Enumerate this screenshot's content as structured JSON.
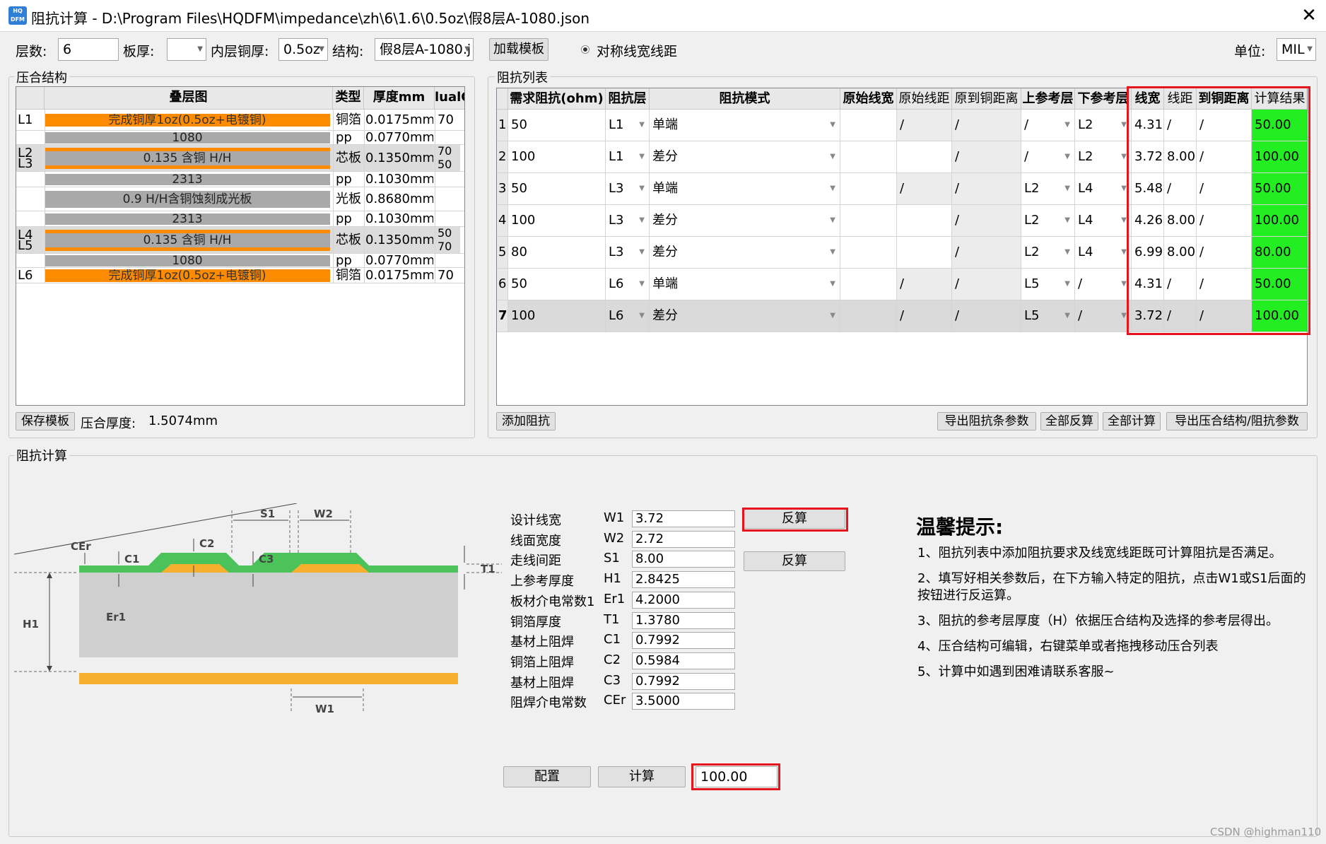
{
  "window": {
    "icon_text": "HQ DFM",
    "title": "阻抗计算 - D:\\Program Files\\HQDFM\\impedance\\zh\\6\\1.6\\0.5oz\\假8层A-1080.json",
    "close_glyph": "✕"
  },
  "toolbar": {
    "layers_label": "层数:",
    "layers_value": "6",
    "thickness_label": "板厚:",
    "thickness_value": "",
    "inner_cu_label": "内层铜厚:",
    "inner_cu_value": "0.5oz",
    "structure_label": "结构:",
    "structure_value": "假8层A-1080.j",
    "load_template_label": "加载模板",
    "symmetric_radio_label": "对称线宽线距",
    "unit_label": "单位:",
    "unit_value": "MIL"
  },
  "stackup": {
    "group_title": "压合结构",
    "columns": [
      "叠层图",
      "类型",
      "厚度mm",
      "lualCo"
    ],
    "rows": [
      {
        "layer": "L1",
        "diagram": "完成铜厚1oz(0.5oz+电镀铜)",
        "kind": "copper",
        "type": "铜箔",
        "thickness": "0.0175mm",
        "dual": "70"
      },
      {
        "layer": "",
        "diagram": "1080",
        "kind": "pp",
        "type": "pp",
        "thickness": "0.0770mm",
        "dual": ""
      },
      {
        "layer": "L2",
        "layer2": "L3",
        "diagram": "0.135 含铜 H/H",
        "kind": "core",
        "type": "芯板",
        "thickness": "0.1350mm",
        "dual": "70",
        "dual2": "50"
      },
      {
        "layer": "",
        "diagram": "2313",
        "kind": "pp",
        "type": "pp",
        "thickness": "0.1030mm",
        "dual": ""
      },
      {
        "layer": "",
        "diagram": "0.9 H/H含铜蚀刻成光板",
        "kind": "bare",
        "type": "光板",
        "thickness": "0.8680mm",
        "dual": ""
      },
      {
        "layer": "",
        "diagram": "2313",
        "kind": "pp",
        "type": "pp",
        "thickness": "0.1030mm",
        "dual": ""
      },
      {
        "layer": "L4",
        "layer2": "L5",
        "diagram": "0.135 含铜 H/H",
        "kind": "core",
        "type": "芯板",
        "thickness": "0.1350mm",
        "dual": "50",
        "dual2": "70"
      },
      {
        "layer": "",
        "diagram": "1080",
        "kind": "pp",
        "type": "pp",
        "thickness": "0.0770mm",
        "dual": ""
      },
      {
        "layer": "L6",
        "diagram": "完成铜厚1oz(0.5oz+电镀铜)",
        "kind": "copper",
        "type": "铜箔",
        "thickness": "0.0175mm",
        "dual": "70"
      }
    ],
    "save_template_label": "保存模板",
    "total_thickness_label": "压合厚度:",
    "total_thickness_value": "1.5074mm"
  },
  "impedance_list": {
    "group_title": "阻抗列表",
    "columns": [
      "需求阻抗(ohm)",
      "阻抗层",
      "阻抗模式",
      "原始线宽",
      "原始线距",
      "原到铜距离",
      "上参考层",
      "下参考层",
      "线宽",
      "线距",
      "到铜距离",
      "计算结果"
    ],
    "rows": [
      {
        "n": "1",
        "req": "50",
        "layer": "L1",
        "mode": "单端",
        "ow": "",
        "os": "/",
        "oc": "/",
        "top": "/",
        "bot": "L2",
        "w": "4.31",
        "s": "/",
        "c": "/",
        "result": "50.00"
      },
      {
        "n": "2",
        "req": "100",
        "layer": "L1",
        "mode": "差分",
        "ow": "",
        "os": "",
        "oc": "/",
        "top": "/",
        "bot": "L2",
        "w": "3.72",
        "s": "8.00",
        "c": "/",
        "result": "100.00"
      },
      {
        "n": "3",
        "req": "50",
        "layer": "L3",
        "mode": "单端",
        "ow": "",
        "os": "/",
        "oc": "/",
        "top": "L2",
        "bot": "L4",
        "w": "5.48",
        "s": "/",
        "c": "/",
        "result": "50.00"
      },
      {
        "n": "4",
        "req": "100",
        "layer": "L3",
        "mode": "差分",
        "ow": "",
        "os": "",
        "oc": "/",
        "top": "L2",
        "bot": "L4",
        "w": "4.26",
        "s": "8.00",
        "c": "/",
        "result": "100.00"
      },
      {
        "n": "5",
        "req": "80",
        "layer": "L3",
        "mode": "差分",
        "ow": "",
        "os": "",
        "oc": "/",
        "top": "L2",
        "bot": "L4",
        "w": "6.99",
        "s": "8.00",
        "c": "/",
        "result": "80.00"
      },
      {
        "n": "6",
        "req": "50",
        "layer": "L6",
        "mode": "单端",
        "ow": "",
        "os": "/",
        "oc": "/",
        "top": "L5",
        "bot": "/",
        "w": "4.31",
        "s": "/",
        "c": "/",
        "result": "50.00"
      },
      {
        "n": "7",
        "req": "100",
        "layer": "L6",
        "mode": "差分",
        "ow": "",
        "os": "/",
        "oc": "/",
        "top": "L5",
        "bot": "/",
        "w": "3.72",
        "s": "/",
        "c": "/",
        "result": "100.00"
      }
    ],
    "add_label": "添加阻抗",
    "export_bar_label": "导出阻抗条参数",
    "reverse_all_label": "全部反算",
    "calc_all_label": "全部计算",
    "export_stack_label": "导出压合结构/阻抗参数"
  },
  "calc": {
    "group_title": "阻抗计算",
    "diagram": {
      "S1": "S1",
      "W2": "W2",
      "CEr": "CEr",
      "C1": "C1",
      "C2": "C2",
      "C3": "C3",
      "T1": "T1",
      "H1": "H1",
      "Er1": "Er1",
      "W1": "W1"
    },
    "fields": [
      {
        "label": "设计线宽",
        "sym": "W1",
        "value": "3.72"
      },
      {
        "label": "线面宽度",
        "sym": "W2",
        "value": "2.72"
      },
      {
        "label": "走线间距",
        "sym": "S1",
        "value": "8.00"
      },
      {
        "label": "上参考厚度",
        "sym": "H1",
        "value": "2.8425"
      },
      {
        "label": "板材介电常数1",
        "sym": "Er1",
        "value": "4.2000"
      },
      {
        "label": "铜箔厚度",
        "sym": "T1",
        "value": "1.3780"
      },
      {
        "label": "基材上阻焊",
        "sym": "C1",
        "value": "0.7992"
      },
      {
        "label": "铜箔上阻焊",
        "sym": "C2",
        "value": "0.5984"
      },
      {
        "label": "基材上阻焊",
        "sym": "C3",
        "value": "0.7992"
      },
      {
        "label": "阻焊介电常数",
        "sym": "CEr",
        "value": "3.5000"
      }
    ],
    "reverse_w1_label": "反算",
    "reverse_s1_label": "反算",
    "config_label": "配置",
    "calc_label": "计算",
    "result_value": "100.00",
    "tips_title": "温馨提示:",
    "tips": [
      "1、阻抗列表中添加阻抗要求及线宽线距既可计算阻抗是否满足。",
      "2、填写好相关参数后，在下方输入特定的阻抗，点击W1或S1后面的",
      "按钮进行反运算。",
      "3、阻抗的参考层厚度（H）依据压合结构及选择的参考层得出。",
      "4、压合结构可编辑，右键菜单或者拖拽移动压合列表",
      "5、计算中如遇到困难请联系客服~"
    ]
  },
  "watermark": "CSDN @highman110",
  "colors": {
    "copper": "#ff8c00",
    "prepreg": "#a9a9a9",
    "result_green": "#22ee22",
    "highlight_red": "#e8141b",
    "diagram_green": "#4cc35a",
    "diagram_base": "#cfcfcf",
    "diagram_gold": "#f5b12e"
  }
}
